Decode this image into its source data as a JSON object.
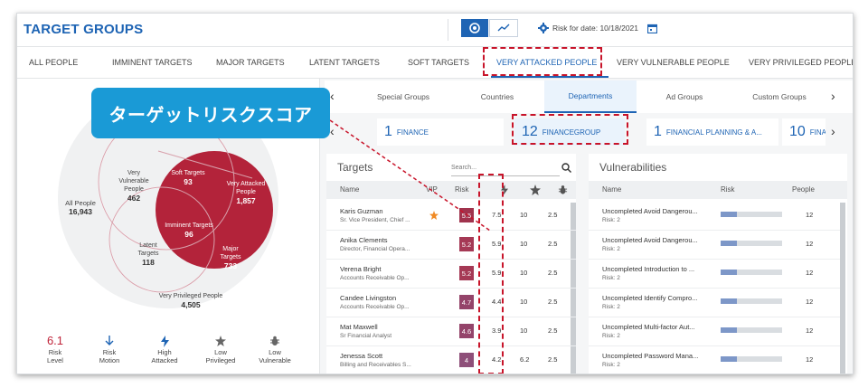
{
  "header": {
    "title": "TARGET GROUPS",
    "risk_date_label": "Risk for date:",
    "risk_date": "10/18/2021"
  },
  "nav_tabs": [
    "ALL PEOPLE",
    "IMMINENT TARGETS",
    "MAJOR TARGETS",
    "LATENT TARGETS",
    "SOFT TARGETS",
    "VERY ATTACKED PEOPLE",
    "VERY VULNERABLE PEOPLE",
    "VERY PRIVILEGED PEOPLE"
  ],
  "active_nav_tab": "VERY ATTACKED PEOPLE",
  "callout": "ターゲットリスクスコア",
  "venn": {
    "all_people": {
      "label": "All People",
      "value": "16,943"
    },
    "very_vulnerable": {
      "label": "Very Vulnerable People",
      "value": "462"
    },
    "soft_targets": {
      "label": "Soft Targets",
      "value": "93"
    },
    "very_attacked": {
      "label": "Very Attacked People",
      "value": "1,857"
    },
    "imminent_targets": {
      "label": "Imminent Targets",
      "value": "96"
    },
    "latent_targets": {
      "label": "Latent Targets",
      "value": "118"
    },
    "major_targets": {
      "label": "Major Targets",
      "value": "733"
    },
    "very_privileged": {
      "label": "Very Privileged People",
      "value": "4,505"
    }
  },
  "metrics": {
    "risk_level": {
      "value": "6.1",
      "label": "Risk Level"
    },
    "risk_motion": {
      "label": "Risk Motion"
    },
    "high_attacked": {
      "label": "High Attacked"
    },
    "low_privileged": {
      "label": "Low Privileged"
    },
    "low_vulnerable": {
      "label": "Low Vulnerable"
    }
  },
  "sub_tabs": [
    "Special Groups",
    "Countries",
    "Departments",
    "Ad Groups",
    "Custom Groups"
  ],
  "active_sub_tab": "Departments",
  "group_cards": [
    {
      "num": "1",
      "label": "FINANCE"
    },
    {
      "num": "12",
      "label": "FINANCEGROUP"
    },
    {
      "num": "1",
      "label": "FINANCIAL PLANNING & A..."
    },
    {
      "num": "10",
      "label": "FINA"
    }
  ],
  "targets": {
    "title": "Targets",
    "search_placeholder": "Search...",
    "columns": {
      "name": "Name",
      "vip": "VIP",
      "risk": "Risk"
    },
    "rows": [
      {
        "name": "Karis Guzman",
        "title": "Sr. Vice President, Chief ...",
        "risk": "5.5",
        "attacked": "7.5",
        "privileged": "10",
        "vulnerable": "2.5",
        "risk_color": "#a0334d"
      },
      {
        "name": "Anika Clements",
        "title": "Director, Financial Opera...",
        "risk": "5.2",
        "attacked": "5.9",
        "privileged": "10",
        "vulnerable": "2.5",
        "risk_color": "#a53955"
      },
      {
        "name": "Verena Bright",
        "title": "Accounts Receivable Op...",
        "risk": "5.2",
        "attacked": "5.9",
        "privileged": "10",
        "vulnerable": "2.5",
        "risk_color": "#a53955"
      },
      {
        "name": "Candee Livingston",
        "title": "Accounts Receivable Op...",
        "risk": "4.7",
        "attacked": "4.4",
        "privileged": "10",
        "vulnerable": "2.5",
        "risk_color": "#94446a"
      },
      {
        "name": "Mat Maxwell",
        "title": "Sr Financial Analyst",
        "risk": "4.6",
        "attacked": "3.9",
        "privileged": "10",
        "vulnerable": "2.5",
        "risk_color": "#94446a"
      },
      {
        "name": "Jenessa Scott",
        "title": "Billing and Receivables S...",
        "risk": "4",
        "attacked": "4.2",
        "privileged": "6.2",
        "vulnerable": "2.5",
        "risk_color": "#8e4f79"
      }
    ]
  },
  "vulnerabilities": {
    "title": "Vulnerabilities",
    "columns": {
      "name": "Name",
      "risk": "Risk",
      "people": "People"
    },
    "rows": [
      {
        "name": "Uncompleted Avoid Dangerou...",
        "risk": "Risk: 2",
        "people": "12"
      },
      {
        "name": "Uncompleted Avoid Dangerou...",
        "risk": "Risk: 2",
        "people": "12"
      },
      {
        "name": "Uncompleted Introduction to ...",
        "risk": "Risk: 2",
        "people": "12"
      },
      {
        "name": "Uncompleted Identify Compro...",
        "risk": "Risk: 2",
        "people": "12"
      },
      {
        "name": "Uncompleted Multi-factor Aut...",
        "risk": "Risk: 2",
        "people": "12"
      },
      {
        "name": "Uncompleted Password Mana...",
        "risk": "Risk: 2",
        "people": "12"
      }
    ]
  },
  "colors": {
    "accent": "#1e64b4",
    "callout": "#1a9ad6",
    "highlight": "#c8142a",
    "venn_red": "#b3233a"
  }
}
